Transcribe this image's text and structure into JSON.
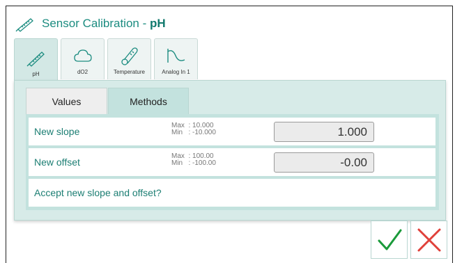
{
  "header": {
    "title_prefix": "Sensor Calibration - ",
    "title_sensor": "pH",
    "icon": "thermometer-probe-icon"
  },
  "sensor_tabs": [
    {
      "label": "pH",
      "icon": "probe-icon",
      "active": true
    },
    {
      "label": "dO2",
      "icon": "cloud-icon",
      "active": false
    },
    {
      "label": "Temperature",
      "icon": "thermometer-icon",
      "active": false
    },
    {
      "label": "Analog In 1",
      "icon": "sine-wave-icon",
      "active": false
    }
  ],
  "subtabs": {
    "values": "Values",
    "methods": "Methods"
  },
  "rows": {
    "slope": {
      "label": "New slope",
      "max": "Max  : 10.000",
      "min": "Min   : -10.000",
      "value": "1.000"
    },
    "offset": {
      "label": "New offset",
      "max": "Max  : 100.00",
      "min": "Min   : -100.00",
      "value": "-0.00"
    },
    "accept": {
      "label": "Accept new slope and offset?"
    }
  },
  "actions": {
    "ok_icon": "checkmark-icon",
    "cancel_icon": "close-icon"
  },
  "colors": {
    "accent": "#1c8c80",
    "panel": "#d7ebe8",
    "ok": "#1a9a3a",
    "cancel": "#e0403a"
  }
}
